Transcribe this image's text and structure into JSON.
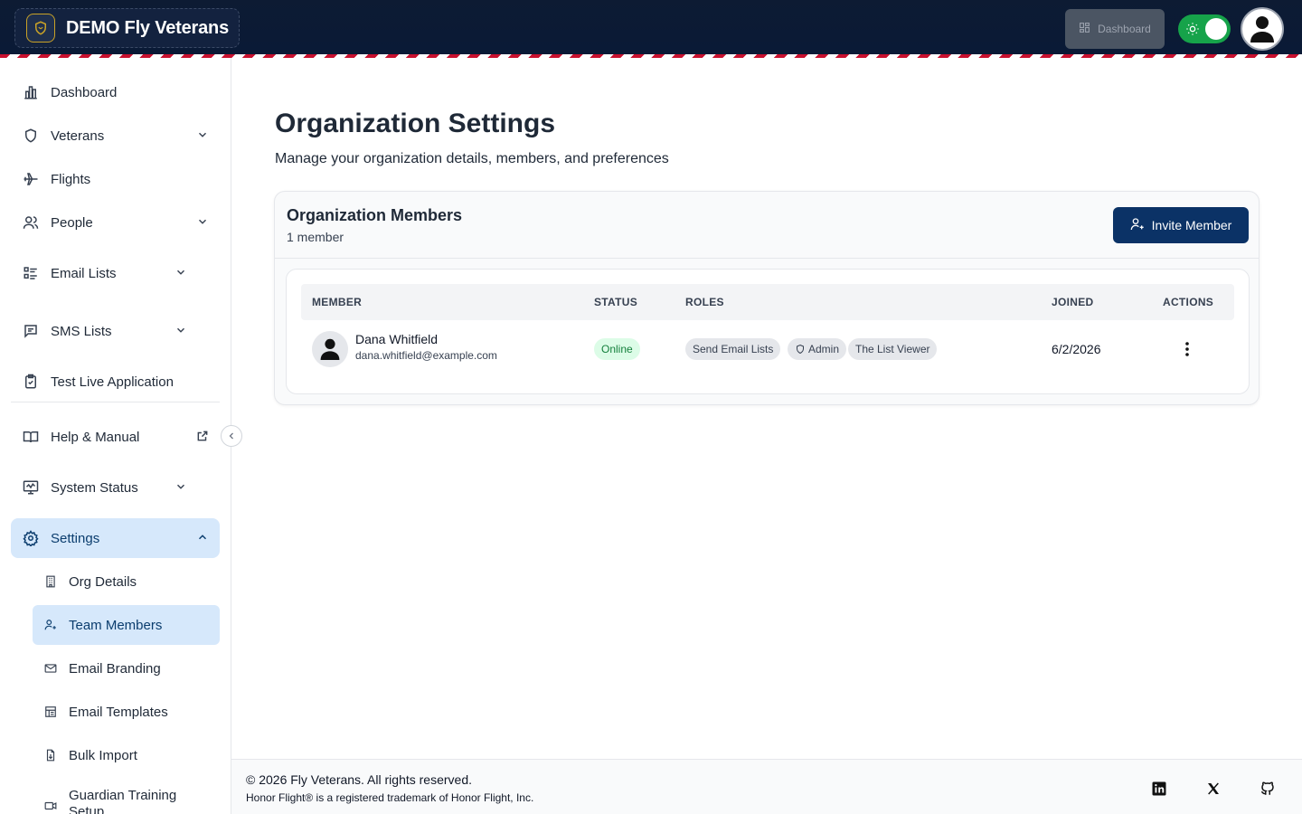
{
  "header": {
    "brand_title": "DEMO Fly Veterans",
    "dashboard_button_label": "Dashboard",
    "accent_color": "#c8102e",
    "navy_color": "#0b3266"
  },
  "sidebar": {
    "items": [
      {
        "label": "Dashboard",
        "icon": "bar-chart-icon"
      },
      {
        "label": "Veterans",
        "icon": "shield-icon"
      },
      {
        "label": "Flights",
        "icon": "plane-icon"
      },
      {
        "label": "People",
        "icon": "users-icon"
      },
      {
        "label": "Email Lists",
        "icon": "list-icon"
      },
      {
        "label": "SMS Lists",
        "icon": "message-icon"
      },
      {
        "label": "Test Live Application",
        "icon": "clipboard-icon"
      },
      {
        "label": "Help & Manual",
        "icon": "book-icon"
      },
      {
        "label": "System Status",
        "icon": "monitor-icon"
      },
      {
        "label": "Settings",
        "icon": "gear-icon"
      }
    ],
    "settings_sub": [
      {
        "label": "Org Details",
        "icon": "building-icon"
      },
      {
        "label": "Team Members",
        "icon": "user-plus-icon"
      },
      {
        "label": "Email Branding",
        "icon": "mail-icon"
      },
      {
        "label": "Email Templates",
        "icon": "template-icon"
      },
      {
        "label": "Bulk Import",
        "icon": "file-import-icon"
      },
      {
        "label": "Guardian Training Setup",
        "icon": "video-icon"
      }
    ]
  },
  "main": {
    "title": "Organization Settings",
    "subtitle": "Manage your organization details, members, and preferences",
    "card": {
      "title": "Organization Members",
      "count": "1 member",
      "invite_label": "Invite Member",
      "columns": {
        "member": "MEMBER",
        "status": "STATUS",
        "roles": "ROLES",
        "joined": "JOINED",
        "actions": "ACTIONS"
      },
      "rows": [
        {
          "name": "Dana Whitfield",
          "email": "dana.whitfield@example.com",
          "status": "Online",
          "roles": [
            "Send Email Lists",
            "Admin",
            "The List Viewer"
          ],
          "joined": "6/2/2026"
        }
      ]
    }
  },
  "footer": {
    "copyright": "© 2026 Fly Veterans. All rights reserved.",
    "trademark": "Honor Flight® is a registered trademark of Honor Flight, Inc.",
    "social_icons": [
      "linkedin-icon",
      "x-icon",
      "github-icon"
    ]
  }
}
